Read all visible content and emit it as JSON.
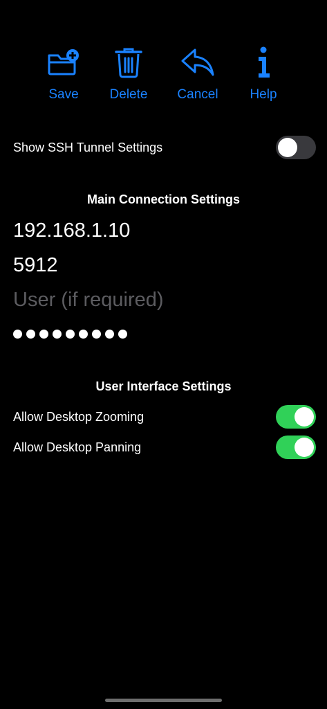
{
  "toolbar": {
    "items": [
      {
        "label": "Save",
        "icon": "folder-plus-icon"
      },
      {
        "label": "Delete",
        "icon": "trash-icon"
      },
      {
        "label": "Cancel",
        "icon": "reply-arrow-icon"
      },
      {
        "label": "Help",
        "icon": "info-icon"
      }
    ]
  },
  "ssh_tunnel": {
    "label": "Show SSH Tunnel Settings",
    "enabled": false
  },
  "main_connection": {
    "title": "Main Connection Settings",
    "address": "192.168.1.10",
    "port": "5912",
    "user_value": "",
    "user_placeholder": "User (if required)",
    "password_dot_count": 9
  },
  "ui_settings": {
    "title": "User Interface Settings",
    "allow_zooming": {
      "label": "Allow Desktop Zooming",
      "enabled": true
    },
    "allow_panning": {
      "label": "Allow Desktop Panning",
      "enabled": true
    }
  },
  "colors": {
    "accent": "#1a82ff",
    "toggle_on": "#30d158",
    "toggle_off": "#39393d",
    "background": "#000000"
  }
}
